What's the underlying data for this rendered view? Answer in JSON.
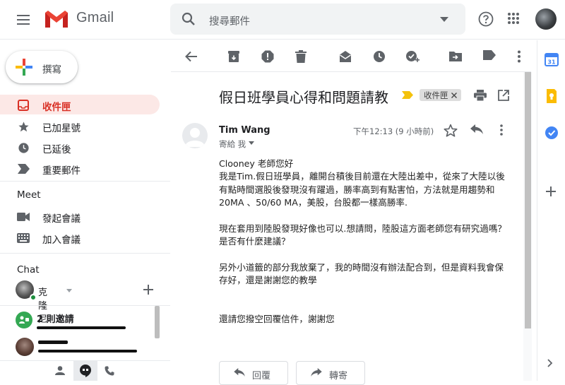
{
  "header": {
    "app_name": "Gmail",
    "search_placeholder": "搜尋郵件"
  },
  "compose": {
    "label": "撰寫"
  },
  "nav": {
    "items": [
      {
        "label": "收件匣",
        "icon": "inbox-icon",
        "active": true
      },
      {
        "label": "已加星號",
        "icon": "star-icon"
      },
      {
        "label": "已延後",
        "icon": "clock-icon"
      },
      {
        "label": "重要郵件",
        "icon": "important-icon"
      }
    ]
  },
  "meet": {
    "title": "Meet",
    "items": [
      {
        "label": "發起會議",
        "icon": "video-icon"
      },
      {
        "label": "加入會議",
        "icon": "keyboard-icon"
      }
    ]
  },
  "chat": {
    "title": "Chat",
    "user_name": "克隆尼",
    "invites": "2 則邀請"
  },
  "email": {
    "subject": "假日班學員心得和問題請教",
    "label_chip": "收件匣",
    "sender": "Tim Wang",
    "recipient": "寄給 我",
    "timestamp": "下午12:13 (9 小時前)",
    "body": [
      "Clooney 老師您好",
      "我是Tim.假日班學員，離開台積後目前還在大陸出差中，從來了大陸以後",
      "有點時間選股後發現沒有躍過，勝率高到有點害怕，方法就是用趨勢和",
      "20MA 、50/60 MA，美股，台股都一樣高勝率.",
      "",
      "現在套用到陸股發現好像也可以.想請問，陸股這方面老師您有研究過嗎？",
      "是否有什麼建議？",
      "",
      "另外小道籤的部分我放棄了，我的時間沒有辦法配合到，但是資料我會保",
      "存好，還是謝謝您的教學",
      "",
      "",
      "",
      "還請您撥空回覆信件，謝謝您"
    ],
    "reply_label": "回覆",
    "forward_label": "轉寄"
  },
  "colors": {
    "accent_red": "#d93025",
    "active_bg": "#fce8e6",
    "important_yellow": "#f4c20d"
  }
}
